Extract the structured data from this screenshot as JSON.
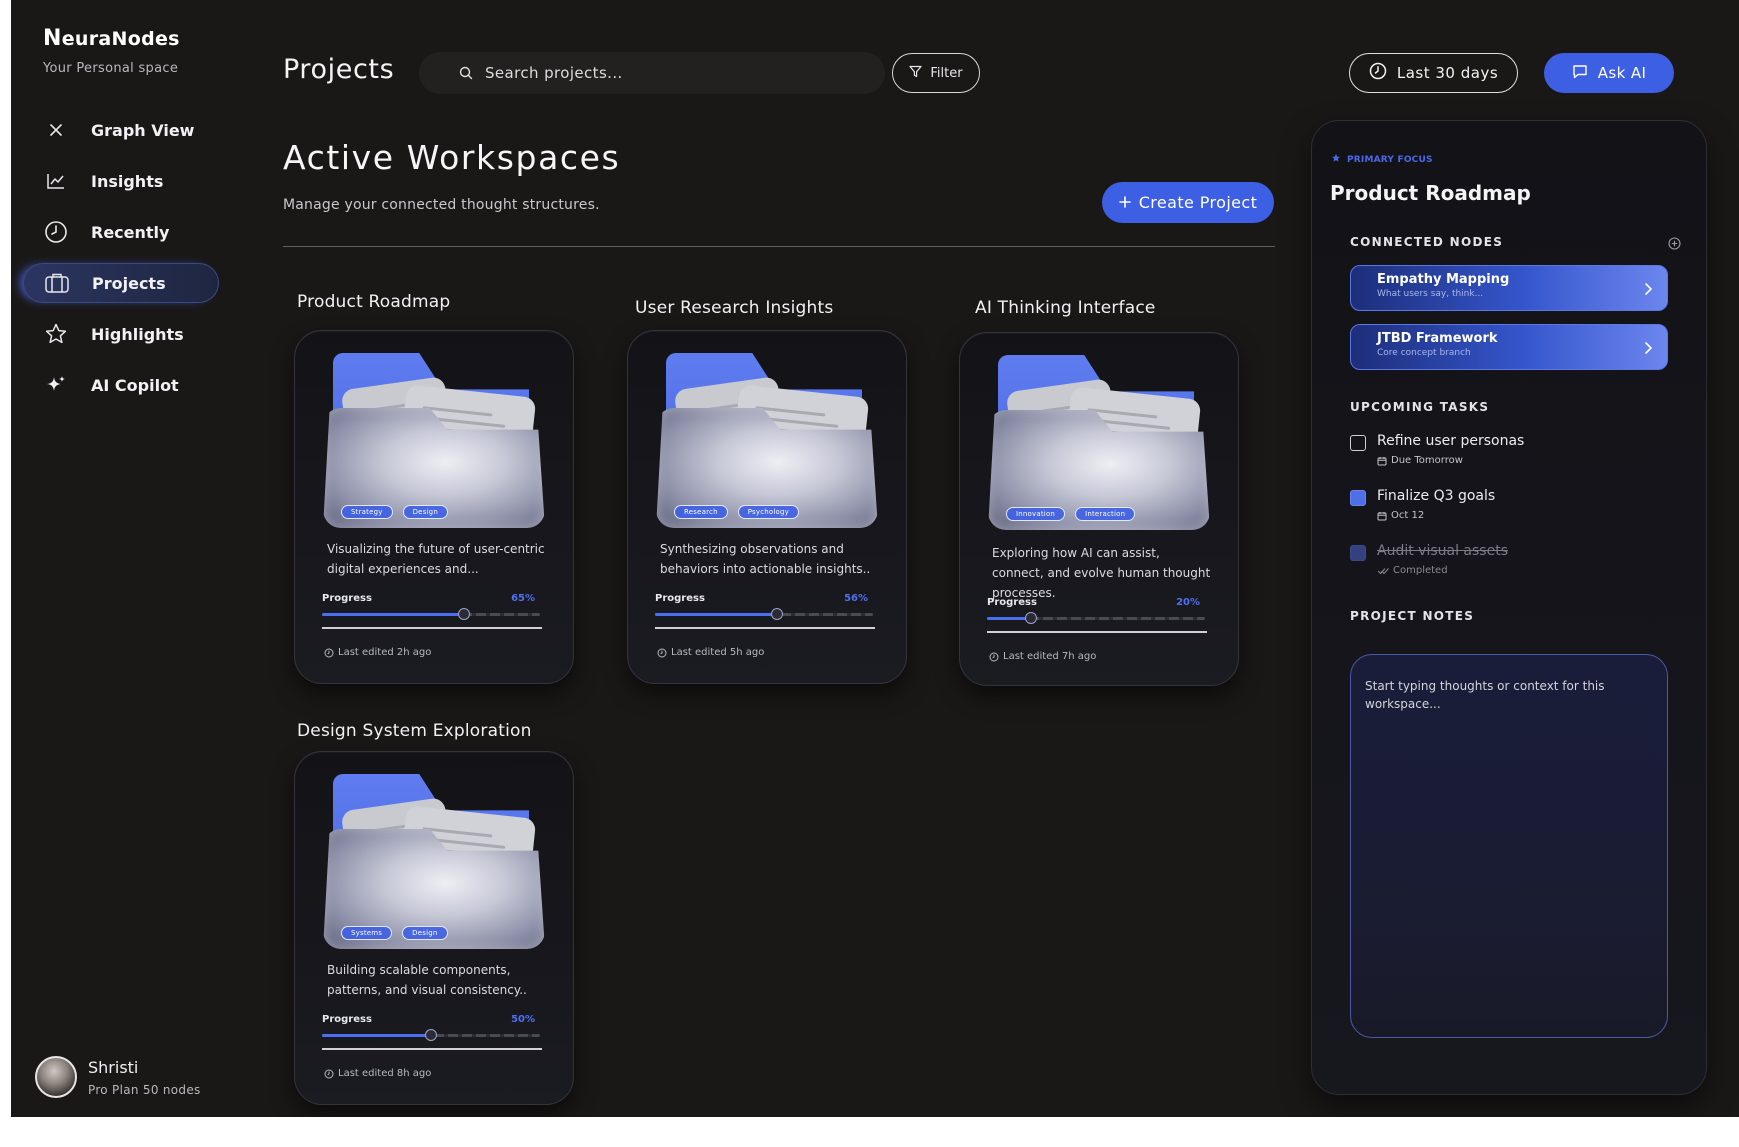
{
  "brand": {
    "logo_initial": "N",
    "logo_rest": "euraNodes",
    "subtitle": "Your Personal space"
  },
  "sidebar": {
    "items": [
      {
        "label": "Graph View",
        "icon": "graph-close-icon",
        "active": false
      },
      {
        "label": "Insights",
        "icon": "chart-line-icon",
        "active": false
      },
      {
        "label": "Recently",
        "icon": "clock-icon",
        "active": false
      },
      {
        "label": "Projects",
        "icon": "briefcase-icon",
        "active": true
      },
      {
        "label": "Highlights",
        "icon": "star-icon",
        "active": false
      },
      {
        "label": "AI Copilot",
        "icon": "sparkle-icon",
        "active": false
      }
    ]
  },
  "user": {
    "name": "Shristi",
    "plan": "Pro Plan 50 nodes"
  },
  "header": {
    "title": "Projects",
    "search_placeholder": "Search projects...",
    "filter_label": "Filter",
    "range_label": "Last 30 days",
    "ask_label": "Ask AI"
  },
  "workspace": {
    "title": "Active Workspaces",
    "subtitle": "Manage your connected thought structures.",
    "create_label": "Create Project"
  },
  "projects": [
    {
      "title": "Product Roadmap",
      "tags": [
        "Strategy",
        "Design"
      ],
      "description": "Visualizing the future of user-centric digital experiences and...",
      "progress_label": "Progress",
      "progress": 65,
      "progress_text": "65%",
      "edited": "Last edited 2h ago"
    },
    {
      "title": "User Research Insights",
      "tags": [
        "Research",
        "Psychology"
      ],
      "description": "Synthesizing observations and behaviors into actionable insights..",
      "progress_label": "Progress",
      "progress": 56,
      "progress_text": "56%",
      "edited": "Last edited 5h ago"
    },
    {
      "title": "AI Thinking Interface",
      "tags": [
        "Innovation",
        "Interaction"
      ],
      "description": "Exploring how AI can assist, connect, and evolve human thought processes.",
      "progress_label": "Progress",
      "progress": 20,
      "progress_text": "20%",
      "edited": "Last edited 7h ago"
    },
    {
      "title": "Design System Exploration",
      "tags": [
        "Systems",
        "Design"
      ],
      "description": "Building scalable components, patterns, and visual consistency..",
      "progress_label": "Progress",
      "progress": 50,
      "progress_text": "50%",
      "edited": "Last edited 8h ago"
    }
  ],
  "panel": {
    "focus_label": "PRIMARY FOCUS",
    "title": "Product Roadmap",
    "nodes_heading": "CONNECTED NODES",
    "nodes": [
      {
        "title": "Empathy Mapping",
        "subtitle": "What users say, think..."
      },
      {
        "title": "JTBD Framework",
        "subtitle": "Core concept branch"
      }
    ],
    "tasks_heading": "UPCOMING TASKS",
    "tasks": [
      {
        "name": "Refine user personas",
        "meta": "Due Tomorrow",
        "state": "unchecked"
      },
      {
        "name": "Finalize Q3 goals",
        "meta": "Oct 12",
        "state": "checked"
      },
      {
        "name": "Audit visual assets",
        "meta": "Completed",
        "state": "done"
      }
    ],
    "notes_heading": "PROJECT NOTES",
    "notes_placeholder": "Start typing thoughts or context for this workspace..."
  },
  "colors": {
    "accent": "#3d5fe4",
    "background": "#1a1817",
    "panel": "#15151b"
  }
}
